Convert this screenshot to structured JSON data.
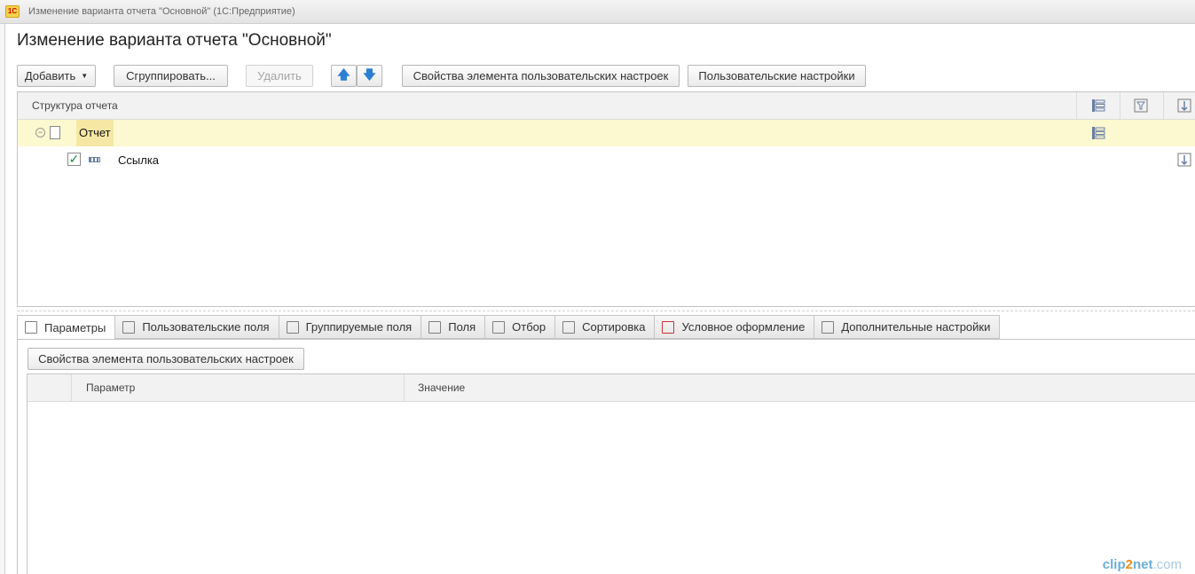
{
  "window": {
    "title": "Изменение варианта отчета \"Основной\"  (1С:Предприятие)"
  },
  "page": {
    "title": "Изменение варианта отчета \"Основной\""
  },
  "toolbar": {
    "add_label": "Добавить",
    "group_label": "Сгруппировать...",
    "delete_label": "Удалить",
    "move_up": "🡅",
    "move_down": "🡇",
    "element_props_label": "Свойства элемента пользовательских настроек",
    "user_settings_label": "Пользовательские настройки"
  },
  "structure": {
    "header": "Структура отчета",
    "rows": [
      {
        "label": "Отчет",
        "expanded": true
      },
      {
        "label": "Ссылка",
        "checked": true
      }
    ]
  },
  "tabs": [
    {
      "label": "Параметры",
      "icon": "params-icon",
      "active": true
    },
    {
      "label": "Пользовательские поля",
      "icon": "custom-fields-icon"
    },
    {
      "label": "Группируемые поля",
      "icon": "group-fields-icon"
    },
    {
      "label": "Поля",
      "icon": "fields-icon"
    },
    {
      "label": "Отбор",
      "icon": "filter-icon"
    },
    {
      "label": "Сортировка",
      "icon": "sort-icon"
    },
    {
      "label": "Условное оформление",
      "icon": "conditional-format-icon"
    },
    {
      "label": "Дополнительные настройки",
      "icon": "additional-settings-icon"
    }
  ],
  "params": {
    "element_props_label": "Свойства элемента пользовательских настроек",
    "columns": [
      "Параметр",
      "Значение"
    ]
  },
  "watermark": {
    "part1": "clip",
    "part2": "2",
    "part3": "net",
    "part4": ".com"
  }
}
